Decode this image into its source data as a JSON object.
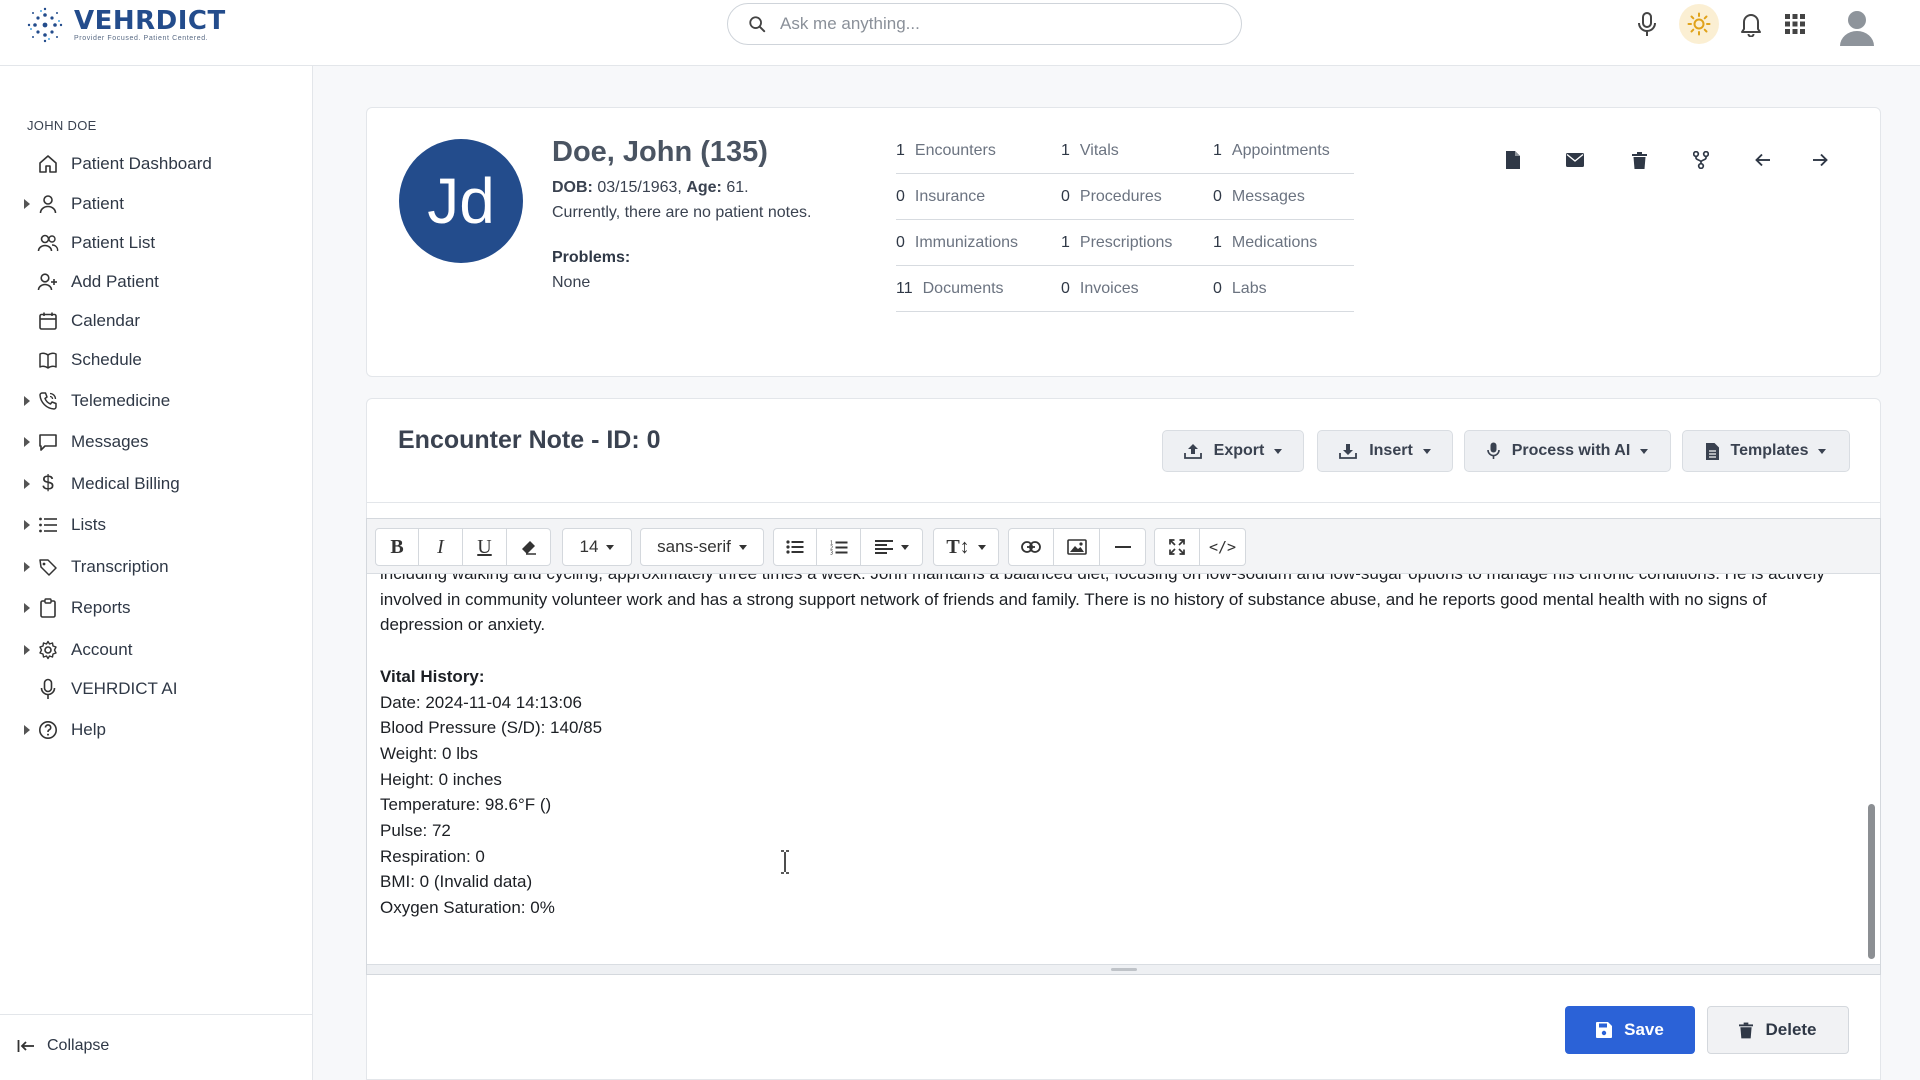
{
  "app": {
    "logo_title": "VEHRDICT",
    "logo_tagline": "Provider Focused. Patient Centered.",
    "search_placeholder": "Ask me anything..."
  },
  "sidebar": {
    "user": "JOHN DOE",
    "items": [
      {
        "label": "Patient Dashboard",
        "icon": "home-icon",
        "expandable": false
      },
      {
        "label": "Patient",
        "icon": "person-icon",
        "expandable": true
      },
      {
        "label": "Patient List",
        "icon": "people-icon",
        "expandable": false
      },
      {
        "label": "Add Patient",
        "icon": "add-person-icon",
        "expandable": false
      },
      {
        "label": "Calendar",
        "icon": "calendar-icon",
        "expandable": false
      },
      {
        "label": "Schedule",
        "icon": "book-icon",
        "expandable": false
      },
      {
        "label": "Telemedicine",
        "icon": "phone-icon",
        "expandable": true
      },
      {
        "label": "Messages",
        "icon": "chat-icon",
        "expandable": true
      },
      {
        "label": "Medical Billing",
        "icon": "dollar-icon",
        "expandable": true
      },
      {
        "label": "Lists",
        "icon": "list-icon",
        "expandable": true
      },
      {
        "label": "Transcription",
        "icon": "transcription-icon",
        "expandable": true
      },
      {
        "label": "Reports",
        "icon": "clipboard-icon",
        "expandable": true
      },
      {
        "label": "Account",
        "icon": "gear-icon",
        "expandable": true
      },
      {
        "label": "VEHRDICT AI",
        "icon": "microphone-icon",
        "expandable": false
      },
      {
        "label": "Help",
        "icon": "help-icon",
        "expandable": true
      }
    ],
    "collapse_label": "Collapse"
  },
  "patient": {
    "initials": "Jd",
    "name": "Doe, John (135)",
    "dob_label": "DOB:",
    "dob": "03/15/1963,",
    "age_label": "Age:",
    "age": "61.",
    "notes": "Currently, there are no patient notes.",
    "problems_label": "Problems:",
    "problems": "None"
  },
  "stats": [
    [
      {
        "n": "1",
        "l": "Encounters"
      },
      {
        "n": "1",
        "l": "Vitals"
      },
      {
        "n": "1",
        "l": "Appointments"
      }
    ],
    [
      {
        "n": "0",
        "l": "Insurance"
      },
      {
        "n": "0",
        "l": "Procedures"
      },
      {
        "n": "0",
        "l": "Messages"
      }
    ],
    [
      {
        "n": "0",
        "l": "Immunizations"
      },
      {
        "n": "1",
        "l": "Prescriptions"
      },
      {
        "n": "1",
        "l": "Medications"
      }
    ],
    [
      {
        "n": "11",
        "l": "Documents"
      },
      {
        "n": "0",
        "l": "Invoices"
      },
      {
        "n": "0",
        "l": "Labs"
      }
    ]
  ],
  "encounter": {
    "title": "Encounter Note - ID: 0",
    "export_label": "Export",
    "insert_label": "Insert",
    "process_label": "Process with AI",
    "templates_label": "Templates"
  },
  "toolbar": {
    "font_size": "14",
    "font_family": "sans-serif"
  },
  "note": {
    "paragraph": "including walking and cycling, approximately three times a week. John maintains a balanced diet, focusing on low-sodium and low-sugar options to manage his chronic conditions. He is actively involved in community volunteer work and has a strong support network of friends and family. There is no history of substance abuse, and he reports good mental health with no signs of depression or anxiety.",
    "vital_title": "Vital History:",
    "vital_lines": [
      "Date: 2024-11-04 14:13:06",
      "Blood Pressure (S/D): 140/85",
      "Weight: 0 lbs",
      "Height: 0 inches",
      "Temperature: 98.6°F ()",
      "Pulse: 72",
      "Respiration: 0",
      "BMI: 0 (Invalid data)",
      "Oxygen Saturation: 0%"
    ]
  },
  "actions": {
    "save_label": "Save",
    "delete_label": "Delete"
  },
  "colors": {
    "brand": "#234c8c",
    "primary_button": "#2b62d7",
    "theme_toggle_bg": "#fbefd3"
  }
}
